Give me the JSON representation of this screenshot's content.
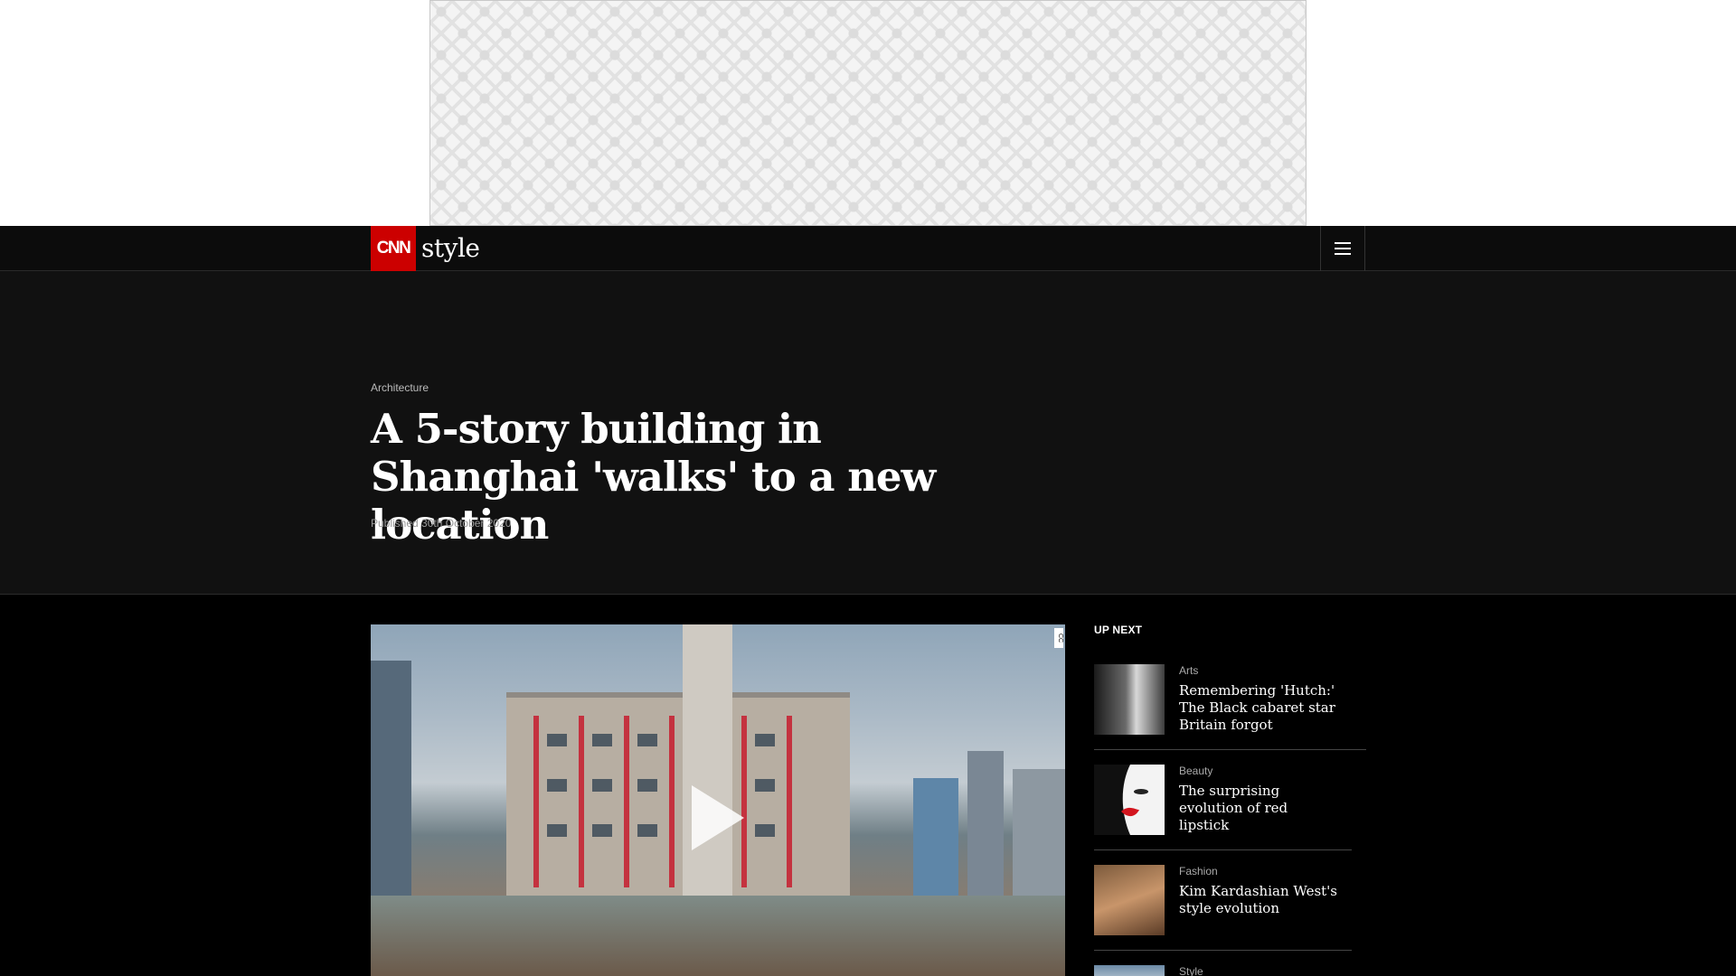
{
  "nav": {
    "logo_text": "CNN",
    "section_word": "style",
    "menu_icon": "hamburger-menu-icon"
  },
  "article": {
    "category": "Architecture",
    "headline": "A 5-story building in Shanghai 'walks' to a new location",
    "published": "Published 30th October 2020"
  },
  "video": {
    "play_icon": "play-icon",
    "cc_tag": "CC"
  },
  "up_next": {
    "label": "UP NEXT",
    "items": [
      {
        "category": "Arts",
        "title": "Remembering 'Hutch:' The Black cabaret star Britain forgot"
      },
      {
        "category": "Beauty",
        "title": "The surprising evolution of red lipstick"
      },
      {
        "category": "Fashion",
        "title": "Kim Kardashian West's style evolution"
      },
      {
        "category": "Style",
        "title": ""
      }
    ]
  },
  "colors": {
    "brand_red": "#cc0000",
    "hero_bg": "#111111",
    "page_bg": "#000000"
  }
}
